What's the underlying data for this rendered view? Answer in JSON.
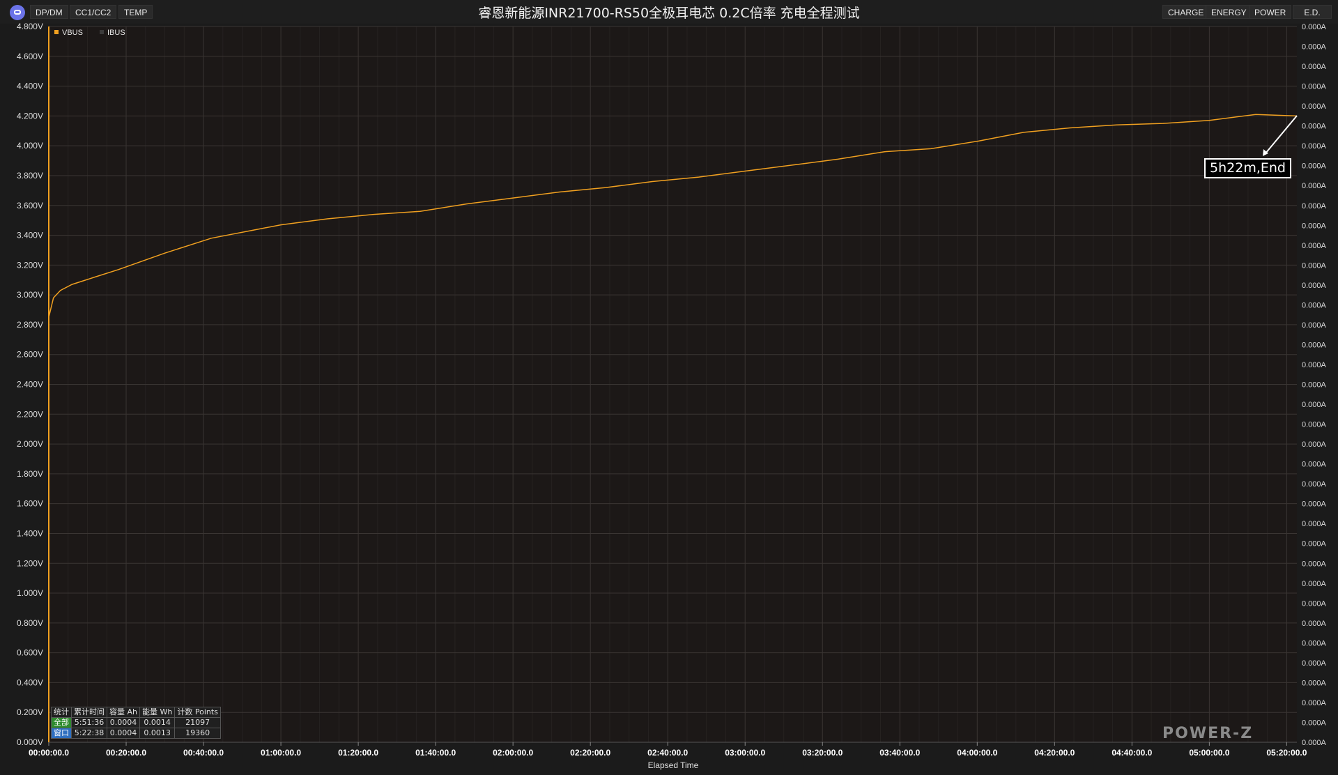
{
  "toolbar": {
    "left_tabs": [
      "DP/DM",
      "CC1/CC2",
      "TEMP"
    ],
    "right_tabs": [
      "CHARGE",
      "ENERGY",
      "POWER",
      "E.D."
    ]
  },
  "title": "睿恩新能源INR21700-RS50全极耳电芯 0.2C倍率 充电全程测试",
  "legend": [
    {
      "name": "VBUS",
      "color": "#f0a020"
    },
    {
      "name": "IBUS",
      "color": "#3a3a3a"
    }
  ],
  "chart_data": {
    "type": "line",
    "xlabel": "Elapsed Time",
    "x_unit": "hours",
    "x_range": [
      0,
      5.3772
    ],
    "x_ticks": [
      "00:00:00.0",
      "00:20:00.0",
      "00:40:00.0",
      "01:00:00.0",
      "01:20:00.0",
      "01:40:00.0",
      "02:00:00.0",
      "02:20:00.0",
      "02:40:00.0",
      "03:00:00.0",
      "03:20:00.0",
      "03:40:00.0",
      "04:00:00.0",
      "04:20:00.0",
      "04:40:00.0",
      "05:00:00.0",
      "05:20:00.0"
    ],
    "y_left": {
      "label": "VBUS",
      "unit": "V",
      "range": [
        0,
        4.8
      ],
      "ticks": [
        "0.000V",
        "0.200V",
        "0.400V",
        "0.600V",
        "0.800V",
        "1.000V",
        "1.200V",
        "1.400V",
        "1.600V",
        "1.800V",
        "2.000V",
        "2.200V",
        "2.400V",
        "2.600V",
        "2.800V",
        "3.000V",
        "3.200V",
        "3.400V",
        "3.600V",
        "3.800V",
        "4.000V",
        "4.200V",
        "4.400V",
        "4.600V",
        "4.800V"
      ]
    },
    "y_right": {
      "label": "IBUS",
      "unit": "A",
      "tick_label": "0.000A",
      "tick_count": 37
    },
    "series": [
      {
        "name": "VBUS",
        "color": "#f0a020",
        "x": [
          0,
          0.02,
          0.05,
          0.1,
          0.2,
          0.3,
          0.5,
          0.7,
          0.9,
          1.0,
          1.2,
          1.4,
          1.6,
          1.8,
          2.0,
          2.2,
          2.4,
          2.6,
          2.8,
          3.0,
          3.2,
          3.4,
          3.6,
          3.8,
          4.0,
          4.2,
          4.4,
          4.6,
          4.8,
          5.0,
          5.2,
          5.3772
        ],
        "y": [
          2.85,
          2.98,
          3.03,
          3.07,
          3.12,
          3.17,
          3.28,
          3.38,
          3.44,
          3.47,
          3.51,
          3.54,
          3.56,
          3.61,
          3.65,
          3.69,
          3.72,
          3.76,
          3.79,
          3.83,
          3.87,
          3.91,
          3.96,
          3.98,
          4.03,
          4.09,
          4.12,
          4.14,
          4.15,
          4.17,
          4.21,
          4.2
        ]
      }
    ],
    "annotation": "5h22m,End"
  },
  "stats": {
    "headers": [
      "统计",
      "累计时间",
      "容量 Ah",
      "能量 Wh",
      "计数 Points"
    ],
    "rows": [
      {
        "label": "全部",
        "time": "5:51:36",
        "capacity": "0.0004",
        "energy": "0.0014",
        "points": "21097"
      },
      {
        "label": "窗口",
        "time": "5:22:38",
        "capacity": "0.0004",
        "energy": "0.0013",
        "points": "19360"
      }
    ]
  },
  "watermark": "POWER-Z"
}
